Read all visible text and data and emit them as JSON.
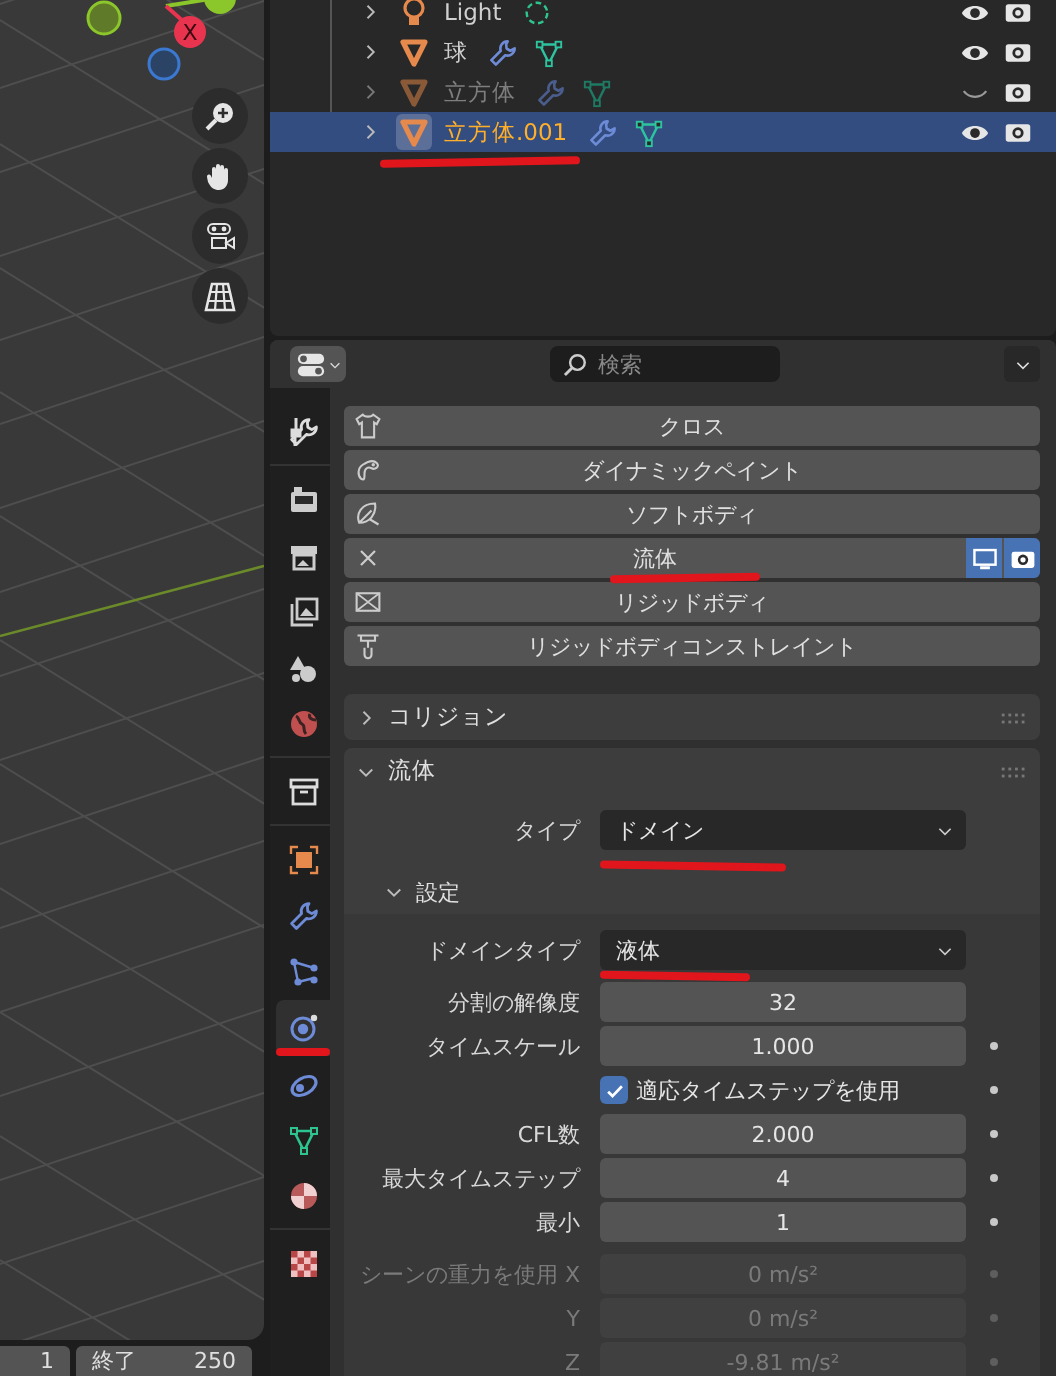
{
  "viewport": {
    "gizmo": {
      "x_label": "X"
    }
  },
  "timeline": {
    "start": "1",
    "end_label": "終了",
    "end": "250"
  },
  "outliner": {
    "rows": [
      {
        "name": "Light",
        "kind": "light",
        "visible": true,
        "selected": false,
        "underlined": false
      },
      {
        "name": "球",
        "kind": "mesh",
        "visible": true,
        "selected": false,
        "underlined": false
      },
      {
        "name": "立方体",
        "kind": "mesh",
        "visible": false,
        "selected": false,
        "underlined": false
      },
      {
        "name": "立方体.001",
        "kind": "mesh",
        "visible": true,
        "selected": true,
        "underlined": true
      }
    ]
  },
  "properties": {
    "search": {
      "placeholder": "検索"
    },
    "tab_groups": [
      [
        {
          "kind": "tool",
          "selected": false,
          "underlined": false
        }
      ],
      [
        {
          "kind": "render",
          "selected": false,
          "underlined": false
        },
        {
          "kind": "output",
          "selected": false,
          "underlined": false
        },
        {
          "kind": "view_layer",
          "selected": false,
          "underlined": false
        },
        {
          "kind": "scene",
          "selected": false,
          "underlined": false
        },
        {
          "kind": "world",
          "selected": false,
          "underlined": false
        }
      ],
      [
        {
          "kind": "collection",
          "selected": false,
          "underlined": false
        }
      ],
      [
        {
          "kind": "object",
          "selected": false,
          "underlined": false
        },
        {
          "kind": "modifiers",
          "selected": false,
          "underlined": false
        },
        {
          "kind": "particles",
          "selected": false,
          "underlined": false
        },
        {
          "kind": "physics",
          "selected": true,
          "underlined": true
        },
        {
          "kind": "constraints",
          "selected": false,
          "underlined": false
        },
        {
          "kind": "data",
          "selected": false,
          "underlined": false
        },
        {
          "kind": "material",
          "selected": false,
          "underlined": false
        }
      ],
      [
        {
          "kind": "texture",
          "selected": false,
          "underlined": false
        }
      ]
    ],
    "physics_buttons": [
      {
        "label": "クロス",
        "kind": "cloth",
        "enabled": false,
        "underlined": false
      },
      {
        "label": "ダイナミックペイント",
        "kind": "dynamic_paint",
        "enabled": false,
        "underlined": false
      },
      {
        "label": "ソフトボディ",
        "kind": "soft_body",
        "enabled": false,
        "underlined": false
      },
      {
        "label": "流体",
        "kind": "fluid",
        "enabled": true,
        "underlined": true
      },
      {
        "label": "リジッドボディ",
        "kind": "rigid_body",
        "enabled": false,
        "underlined": false
      },
      {
        "label": "リジッドボディコンストレイント",
        "kind": "rigid_constraint",
        "enabled": false,
        "underlined": false
      }
    ],
    "panels": [
      {
        "title": "コリジョン",
        "expanded": false
      },
      {
        "title": "流体",
        "expanded": true,
        "rows": [
          {
            "kind": "dropdown",
            "label": "タイプ",
            "value": "ドメイン",
            "underlined": true
          }
        ],
        "subpanels": [
          {
            "title": "設定",
            "expanded": true,
            "rows": [
              {
                "kind": "dropdown",
                "label": "ドメインタイプ",
                "value": "液体",
                "underlined": true
              },
              {
                "kind": "number",
                "label": "分割の解像度",
                "value": "32",
                "decorated": false,
                "disabled": false
              },
              {
                "kind": "number",
                "label": "タイムスケール",
                "value": "1.000",
                "decorated": true,
                "disabled": false
              },
              {
                "kind": "checkbox",
                "label": "適応タイムステップを使用",
                "checked": true,
                "decorated": true
              },
              {
                "kind": "number",
                "label": "CFL数",
                "value": "2.000",
                "decorated": true,
                "disabled": false
              },
              {
                "kind": "number",
                "label": "最大タイムステップ",
                "value": "4",
                "decorated": true,
                "disabled": false
              },
              {
                "kind": "number",
                "label": "最小",
                "value": "1",
                "decorated": true,
                "disabled": false
              },
              {
                "kind": "separator"
              },
              {
                "kind": "number",
                "label": "シーンの重力を使用 X",
                "value": "0 m/s²",
                "decorated": true,
                "disabled": true
              },
              {
                "kind": "number",
                "label": "Y",
                "value": "0 m/s²",
                "decorated": true,
                "disabled": true
              },
              {
                "kind": "number",
                "label": "Z",
                "value": "-9.81 m/s²",
                "decorated": true,
                "disabled": true
              }
            ]
          }
        ]
      }
    ]
  }
}
